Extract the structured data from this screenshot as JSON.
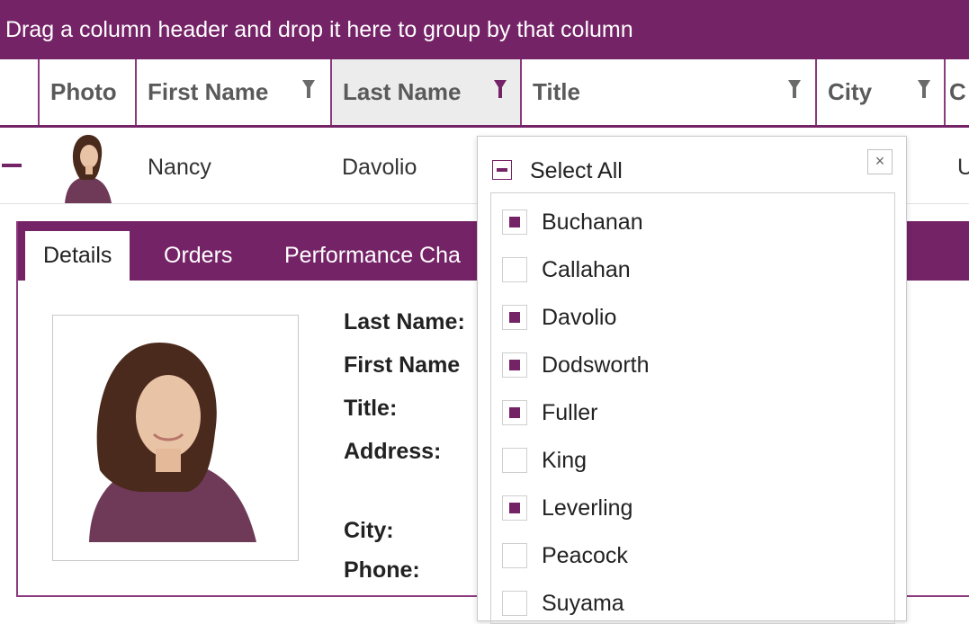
{
  "group_panel": {
    "text": "Drag a column header and drop it here to group by that column"
  },
  "columns": [
    {
      "label": "Photo",
      "filter": false
    },
    {
      "label": "First Name",
      "filter": true,
      "active": false
    },
    {
      "label": "Last Name",
      "filter": true,
      "active": true
    },
    {
      "label": "Title",
      "filter": true,
      "active": false
    },
    {
      "label": "City",
      "filter": true,
      "active": false
    },
    {
      "label": "C"
    }
  ],
  "row": {
    "expanded": true,
    "first_name": "Nancy",
    "last_name": "Davolio",
    "city_partial": "U"
  },
  "details": {
    "tabs": [
      "Details",
      "Orders",
      "Performance Cha"
    ],
    "selected_tab": "Details",
    "labels": {
      "last_name": "Last Name:",
      "first_name": "First Name",
      "title": "Title:",
      "address": "Address:",
      "city": "City:",
      "phone": "Phone:"
    }
  },
  "filter_popup": {
    "select_all_label": "Select All",
    "select_all_state": "indeterminate",
    "close_glyph": "×",
    "items": [
      {
        "label": "Buchanan",
        "checked": true
      },
      {
        "label": "Callahan",
        "checked": false
      },
      {
        "label": "Davolio",
        "checked": true
      },
      {
        "label": "Dodsworth",
        "checked": true
      },
      {
        "label": "Fuller",
        "checked": true
      },
      {
        "label": "King",
        "checked": false
      },
      {
        "label": "Leverling",
        "checked": true
      },
      {
        "label": "Peacock",
        "checked": false
      },
      {
        "label": "Suyama",
        "checked": false
      }
    ]
  },
  "theme": {
    "accent": "#752367",
    "border": "#8b3a7d"
  },
  "icons": {
    "filter": "funnel-icon",
    "collapse": "minus-icon",
    "close": "close-icon"
  }
}
